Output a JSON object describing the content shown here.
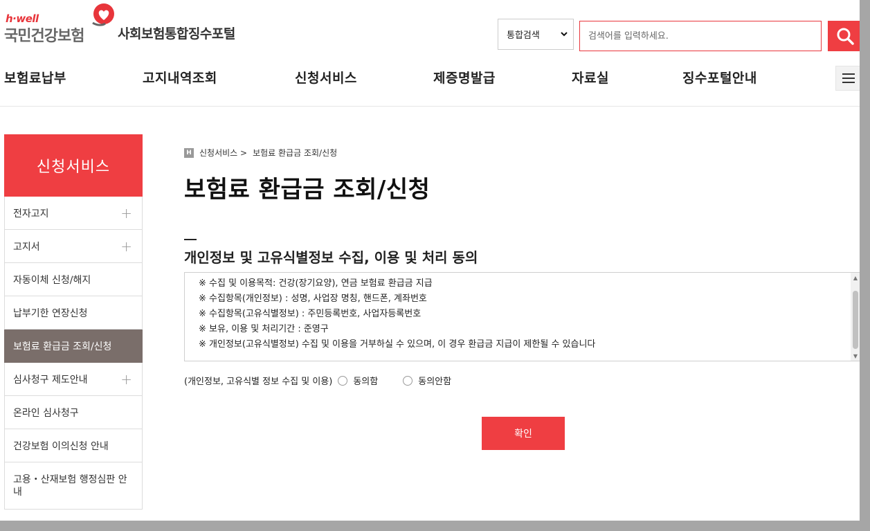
{
  "header": {
    "logo_top": "h·well",
    "logo_main": "국민건강보험",
    "portal_title": "사회보험통합징수포털",
    "search_select_value": "통합검색",
    "search_placeholder": "검색어를 입력하세요."
  },
  "gnb": {
    "items": [
      "보험료납부",
      "고지내역조회",
      "신청서비스",
      "제증명발급",
      "자료실",
      "징수포털안내"
    ]
  },
  "lnb": {
    "title": "신청서비스",
    "items": [
      {
        "label": "전자고지"
      },
      {
        "label": "고지서"
      },
      {
        "label": "자동이체 신청/해지"
      },
      {
        "label": "납부기한 연장신청"
      },
      {
        "label": "보험료 환급금 조회/신청"
      },
      {
        "label": "심사청구 제도안내"
      },
      {
        "label": "온라인 심사청구"
      },
      {
        "label": "건강보험 이의신청 안내"
      },
      {
        "label": "고용・산재보험 행정심판 안내"
      }
    ]
  },
  "content": {
    "breadcrumb_home": "H",
    "breadcrumb": [
      "신청서비스 >",
      "보험료 환급금 조회/신청"
    ],
    "page_title": "보험료 환급금 조회/신청",
    "section_title": "개인정보 및 고유식별정보 수집, 이용 및 처리 동의",
    "terms": [
      "※ 수집 및 이용목적: 건강(장기요양), 연금 보험료 환급금 지급",
      "※ 수집항목(개인정보) : 성명, 사업장 명칭, 핸드폰, 계좌번호",
      "※ 수집항목(고유식별정보) : 주민등록번호, 사업자등록번호",
      "※ 보유, 이용 및 처리기간 : 준영구",
      "※ 개인정보(고유식별정보) 수집 및 이용을 거부하실 수 있으며, 이 경우 환급금 지급이 제한될 수 있습니다"
    ],
    "consent_label": "(개인정보, 고유식별 정보 수집 및 이용)",
    "agree": "동의함",
    "disagree": "동의안함",
    "confirm": "확인"
  }
}
